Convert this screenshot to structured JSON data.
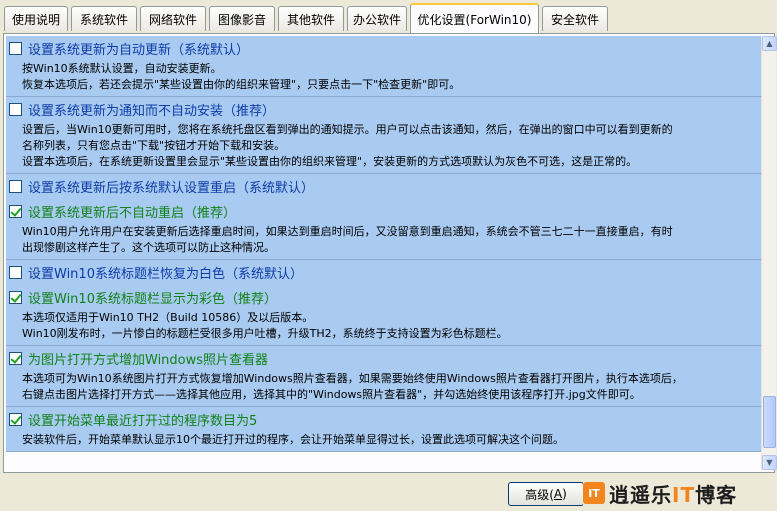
{
  "tabs": [
    {
      "label": "使用说明",
      "active": false
    },
    {
      "label": "系统软件",
      "active": false
    },
    {
      "label": "网络软件",
      "active": false
    },
    {
      "label": "图像影音",
      "active": false
    },
    {
      "label": "其他软件",
      "active": false
    },
    {
      "label": "办公软件",
      "active": false
    },
    {
      "label": "优化设置(ForWin10)",
      "active": true
    },
    {
      "label": "安全软件",
      "active": false
    }
  ],
  "options": [
    {
      "title": "设置系统更新为自动更新（系统默认）",
      "checked": false,
      "recommended": false
    },
    {
      "desc": [
        "按Win10系统默认设置，自动安装更新。",
        "恢复本选项后，若还会提示\"某些设置由你的组织来管理\"，只要点击一下\"检查更新\"即可。"
      ]
    },
    {
      "title": "设置系统更新为通知而不自动安装（推荐）",
      "checked": false,
      "recommended": true
    },
    {
      "desc": [
        "设置后，当Win10更新可用时，您将在系统托盘区看到弹出的通知提示。用户可以点击该通知，然后，在弹出的窗口中可以看到更新的",
        "名称列表，只有您点击\"下载\"按钮才开始下载和安装。",
        "设置本选项后，在系统更新设置里会显示\"某些设置由你的组织来管理\"，安装更新的方式选项默认为灰色不可选，这是正常的。"
      ]
    },
    {
      "title": "设置系统更新后按系统默认设置重启（系统默认）",
      "checked": false,
      "recommended": false
    },
    {
      "title": "设置系统更新后不自动重启（推荐）",
      "checked": true,
      "recommended": true
    },
    {
      "desc": [
        "Win10用户允许用户在安装更新后选择重启时间，如果达到重启时间后，又没留意到重启通知，系统会不管三七二十一直接重启，有时",
        "出现惨剧这样产生了。这个选项可以防止这种情况。"
      ]
    },
    {
      "title": "设置Win10系统标题栏恢复为白色（系统默认）",
      "checked": false,
      "recommended": false
    },
    {
      "title": "设置Win10系统标题栏显示为彩色（推荐）",
      "checked": true,
      "recommended": true
    },
    {
      "desc": [
        "本选项仅适用于Win10 TH2（Build 10586）及以后版本。",
        "Win10刚发布时，一片惨白的标题栏受很多用户吐槽，升级TH2，系统终于支持设置为彩色标题栏。"
      ]
    },
    {
      "title": "为图片打开方式增加Windows照片查看器",
      "checked": true,
      "recommended": true
    },
    {
      "desc": [
        "本选项可为Win10系统图片打开方式恢复增加Windows照片查看器，如果需要始终使用Windows照片查看器打开图片，执行本选项后，",
        "右键点击图片选择打开方式——选择其他应用，选择其中的\"Windows照片查看器\"，并勾选始终使用该程序打开.jpg文件即可。"
      ]
    },
    {
      "title": "设置开始菜单最近打开过的程序数目为5",
      "checked": true,
      "recommended": true
    },
    {
      "desc": [
        "安装软件后，开始菜单默认显示10个最近打开过的程序，会让开始菜单显得过长，设置此选项可解决这个问题。"
      ]
    }
  ],
  "footer": {
    "advanced_label": "高级(",
    "advanced_key": "A",
    "advanced_suffix": ")",
    "logo_mark": "IT",
    "logo_text_a": "逍遥乐",
    "logo_text_hl": "IT",
    "logo_text_b": "博客"
  },
  "colors": {
    "option_bg": "#a9cbf1",
    "title_default": "#0d3ca8",
    "title_recommended": "#11811a",
    "active_tab_accent": "#ffc83c",
    "logo_orange": "#f2851d"
  },
  "icons": [
    "checkbox-icon",
    "scroll-up-arrow-icon",
    "scroll-down-arrow-icon",
    "logo-icon"
  ]
}
